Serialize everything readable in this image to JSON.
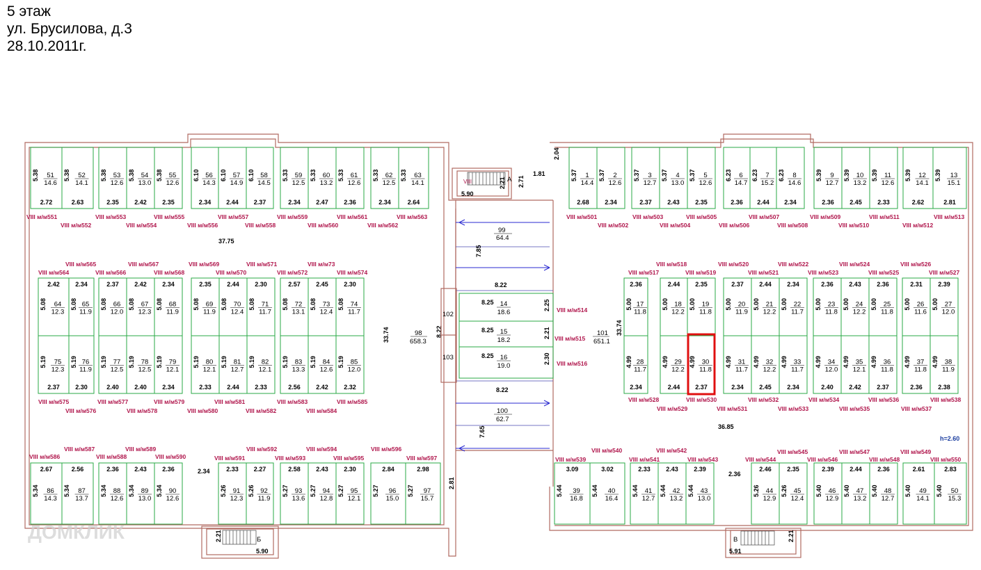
{
  "header": {
    "floor": "5 этаж",
    "address": "ул. Брусилова, д.3",
    "date": "28.10.2011г."
  },
  "watermark": "ДОМКЛИК",
  "colors": {
    "walls": "#b06a62",
    "boxes": "#28a845",
    "labels": "#b0164c",
    "highlight": "#e01010"
  },
  "rooms": [
    {
      "n": "51",
      "a": "14.6",
      "w": "5.38",
      "d": "2.72"
    },
    {
      "n": "52",
      "a": "14.1",
      "w": "5.38",
      "d": "2.63"
    },
    {
      "n": "53",
      "a": "12.6",
      "w": "5.38",
      "d": "2.35"
    },
    {
      "n": "54",
      "a": "13.0",
      "w": "5.38",
      "d": "2.42"
    },
    {
      "n": "55",
      "a": "12.6",
      "w": "5.38",
      "d": "2.35"
    },
    {
      "n": "56",
      "a": "14.3",
      "w": "6.10",
      "d": "2.34"
    },
    {
      "n": "57",
      "a": "14.9",
      "w": "6.10",
      "d": "2.44"
    },
    {
      "n": "58",
      "a": "14.5",
      "w": "6.10",
      "d": "2.37"
    },
    {
      "n": "59",
      "a": "12.5",
      "w": "5.33",
      "d": "2.34"
    },
    {
      "n": "60",
      "a": "13.2",
      "w": "5.33",
      "d": "2.47"
    },
    {
      "n": "61",
      "a": "12.6",
      "w": "5.33",
      "d": "2.36"
    },
    {
      "n": "62",
      "a": "12.5",
      "w": "5.33",
      "d": "2.34"
    },
    {
      "n": "63",
      "a": "14.1",
      "w": "5.33",
      "d": "2.64"
    },
    {
      "n": "64",
      "a": "12.3",
      "w": "5.08",
      "d": "2.42"
    },
    {
      "n": "65",
      "a": "11.9",
      "w": "5.08",
      "d": "2.34"
    },
    {
      "n": "66",
      "a": "12.0",
      "w": "5.08",
      "d": "2.37"
    },
    {
      "n": "67",
      "a": "12.3",
      "w": "5.08",
      "d": "2.42"
    },
    {
      "n": "68",
      "a": "11.9",
      "w": "5.08",
      "d": "2.34"
    },
    {
      "n": "69",
      "a": "11.9",
      "w": "5.08",
      "d": "2.35"
    },
    {
      "n": "70",
      "a": "12.4",
      "w": "5.08",
      "d": "2.44"
    },
    {
      "n": "71",
      "a": "11.7",
      "w": "5.08",
      "d": "2.30"
    },
    {
      "n": "72",
      "a": "13.1",
      "w": "5.08",
      "d": "2.57"
    },
    {
      "n": "73",
      "a": "12.4",
      "w": "5.08",
      "d": "2.45"
    },
    {
      "n": "74",
      "a": "11.7",
      "w": "5.08",
      "d": "2.30"
    },
    {
      "n": "75",
      "a": "12.3",
      "w": "5.19",
      "d": "2.37"
    },
    {
      "n": "76",
      "a": "11.9",
      "w": "5.19",
      "d": "2.30"
    },
    {
      "n": "77",
      "a": "12.5",
      "w": "5.19",
      "d": "2.40"
    },
    {
      "n": "78",
      "a": "12.5",
      "w": "5.19",
      "d": "2.40"
    },
    {
      "n": "79",
      "a": "12.1",
      "w": "5.19",
      "d": "2.34"
    },
    {
      "n": "80",
      "a": "12.1",
      "w": "5.19",
      "d": "2.33"
    },
    {
      "n": "81",
      "a": "12.7",
      "w": "5.19",
      "d": "2.44"
    },
    {
      "n": "82",
      "a": "12.1",
      "w": "5.19",
      "d": "2.33"
    },
    {
      "n": "83",
      "a": "13.3",
      "w": "5.19",
      "d": "2.56"
    },
    {
      "n": "84",
      "a": "12.6",
      "w": "5.19",
      "d": "2.42"
    },
    {
      "n": "85",
      "a": "12.0",
      "w": "5.19",
      "d": "2.32"
    },
    {
      "n": "86",
      "a": "14.3",
      "w": "5.34",
      "d": "2.67"
    },
    {
      "n": "87",
      "a": "13.7",
      "w": "5.34",
      "d": "2.56"
    },
    {
      "n": "88",
      "a": "12.6",
      "w": "5.34",
      "d": "2.36"
    },
    {
      "n": "89",
      "a": "13.0",
      "w": "5.34",
      "d": "2.43"
    },
    {
      "n": "90",
      "a": "12.6",
      "w": "5.34",
      "d": "2.36"
    },
    {
      "n": "91",
      "a": "12.3",
      "w": "5.26",
      "d": "2.33"
    },
    {
      "n": "92",
      "a": "11.9",
      "w": "5.26",
      "d": "2.27"
    },
    {
      "n": "93",
      "a": "13.6",
      "w": "5.27",
      "d": "2.58"
    },
    {
      "n": "94",
      "a": "12.8",
      "w": "5.27",
      "d": "2.43"
    },
    {
      "n": "95",
      "a": "12.1",
      "w": "5.27",
      "d": "2.30"
    },
    {
      "n": "96",
      "a": "15.0",
      "w": "5.27",
      "d": "2.84"
    },
    {
      "n": "97",
      "a": "15.7",
      "w": "5.27",
      "d": "2.98"
    },
    {
      "n": "1",
      "a": "14.4",
      "w": "5.37",
      "d": "2.68"
    },
    {
      "n": "2",
      "a": "12.6",
      "w": "5.37",
      "d": "2.34"
    },
    {
      "n": "3",
      "a": "12.7",
      "w": "5.37",
      "d": "2.37"
    },
    {
      "n": "4",
      "a": "13.0",
      "w": "5.37",
      "d": "2.43"
    },
    {
      "n": "5",
      "a": "12.6",
      "w": "5.37",
      "d": "2.35"
    },
    {
      "n": "6",
      "a": "14.7",
      "w": "6.23",
      "d": "2.36"
    },
    {
      "n": "7",
      "a": "15.2",
      "w": "6.23",
      "d": "2.44"
    },
    {
      "n": "8",
      "a": "14.6",
      "w": "6.23",
      "d": "2.34"
    },
    {
      "n": "9",
      "a": "12.7",
      "w": "5.39",
      "d": "2.36"
    },
    {
      "n": "10",
      "a": "13.2",
      "w": "5.39",
      "d": "2.45"
    },
    {
      "n": "11",
      "a": "12.6",
      "w": "5.39",
      "d": "2.33"
    },
    {
      "n": "12",
      "a": "14.1",
      "w": "5.39",
      "d": "2.62"
    },
    {
      "n": "13",
      "a": "15.1",
      "w": "5.39",
      "d": "2.81"
    },
    {
      "n": "17",
      "a": "11.8",
      "w": "5.00",
      "d": "2.36"
    },
    {
      "n": "18",
      "a": "12.2",
      "w": "5.00",
      "d": "2.44"
    },
    {
      "n": "19",
      "a": "11.8",
      "w": "5.00",
      "d": "2.35"
    },
    {
      "n": "20",
      "a": "11.9",
      "w": "5.00",
      "d": "2.37"
    },
    {
      "n": "21",
      "a": "12.2",
      "w": "5.00",
      "d": "2.44"
    },
    {
      "n": "22",
      "a": "11.7",
      "w": "5.00",
      "d": "2.34"
    },
    {
      "n": "23",
      "a": "11.8",
      "w": "5.00",
      "d": "2.36"
    },
    {
      "n": "24",
      "a": "12.2",
      "w": "5.00",
      "d": "2.43"
    },
    {
      "n": "25",
      "a": "11.8",
      "w": "5.00",
      "d": "2.36"
    },
    {
      "n": "26",
      "a": "11.6",
      "w": "5.00",
      "d": "2.31"
    },
    {
      "n": "27",
      "a": "12.0",
      "w": "5.00",
      "d": "2.39"
    },
    {
      "n": "28",
      "a": "11.7",
      "w": "4.99",
      "d": "2.34"
    },
    {
      "n": "29",
      "a": "12.2",
      "w": "4.99",
      "d": "2.44"
    },
    {
      "n": "30",
      "a": "11.8",
      "w": "4.99",
      "d": "2.37"
    },
    {
      "n": "31",
      "a": "11.7",
      "w": "4.99",
      "d": "2.34"
    },
    {
      "n": "32",
      "a": "12.2",
      "w": "4.99",
      "d": "2.45"
    },
    {
      "n": "33",
      "a": "11.7",
      "w": "4.99",
      "d": "2.34"
    },
    {
      "n": "34",
      "a": "12.0",
      "w": "4.99",
      "d": "2.40"
    },
    {
      "n": "35",
      "a": "12.1",
      "w": "4.99",
      "d": "2.42"
    },
    {
      "n": "36",
      "a": "11.8",
      "w": "4.99",
      "d": "2.37"
    },
    {
      "n": "37",
      "a": "11.8",
      "w": "4.99",
      "d": "2.36"
    },
    {
      "n": "38",
      "a": "11.9",
      "w": "4.99",
      "d": "2.38"
    },
    {
      "n": "39",
      "a": "16.8",
      "w": "5.44",
      "d": "3.09"
    },
    {
      "n": "40",
      "a": "16.4",
      "w": "5.44",
      "d": "3.02"
    },
    {
      "n": "41",
      "a": "12.7",
      "w": "5.44",
      "d": "2.33"
    },
    {
      "n": "42",
      "a": "13.2",
      "w": "5.44",
      "d": "2.43"
    },
    {
      "n": "43",
      "a": "13.0",
      "w": "5.44",
      "d": "2.39"
    },
    {
      "n": "44",
      "a": "12.9",
      "w": "5.26",
      "d": "2.46"
    },
    {
      "n": "45",
      "a": "12.4",
      "w": "5.26",
      "d": "2.35"
    },
    {
      "n": "46",
      "a": "12.9",
      "w": "5.40",
      "d": "2.39"
    },
    {
      "n": "47",
      "a": "13.2",
      "w": "5.40",
      "d": "2.44"
    },
    {
      "n": "48",
      "a": "12.7",
      "w": "5.40",
      "d": "2.36"
    },
    {
      "n": "49",
      "a": "14.1",
      "w": "5.40",
      "d": "2.61"
    },
    {
      "n": "50",
      "a": "15.3",
      "w": "5.40",
      "d": "2.83"
    },
    {
      "n": "14",
      "a": "18.6",
      "w": "8.25",
      "d": "2.25"
    },
    {
      "n": "15",
      "a": "18.2",
      "w": "8.25",
      "d": "2.21"
    },
    {
      "n": "16",
      "a": "19.0",
      "w": "8.25",
      "d": "2.30"
    }
  ],
  "labels": {
    "L551": "VIII м/м551",
    "L552": "VIII м/м552",
    "L553": "VIII м/м553",
    "L554": "VIII м/м554",
    "L555": "VIII м/м555",
    "L556": "VIII м/м556",
    "L557": "VIII м/м557",
    "L558": "VIII м/м558",
    "L559": "VIII м/м559",
    "L560": "VIII м/м560",
    "L561": "VIII м/м561",
    "L562": "VIII м/м562",
    "L563": "VIII м/м563",
    "L564": "VIII м/м564",
    "L565": "VIII м/м565",
    "L566": "VIII м/м566",
    "L567": "VIII м/м567",
    "L568": "VIII м/м568",
    "L569": "VIII м/м569",
    "L570": "VIII м/м570",
    "L571": "VIII м/м571",
    "L572": "VIII м/м572",
    "L573": "VIII м/м73",
    "L574": "VIII м/м574",
    "L575": "VIII м/м575",
    "L576": "VIII м/м576",
    "L577": "VIII м/м577",
    "L578": "VIII м/м578",
    "L579": "VIII м/м579",
    "L580": "VIII м/м580",
    "L581": "VIII м/м581",
    "L582": "VIII м/м582",
    "L583": "VIII м/м583",
    "L584": "VIII м/м584",
    "L585": "VIII м/м585",
    "L586": "VIII м/м586",
    "L587": "VIII м/м587",
    "L588": "VIII м/м588",
    "L589": "VIII м/м589",
    "L590": "VIII м/м590",
    "L591": "VIII м/м591",
    "L592": "VIII м/м592",
    "L593": "VIII м/м593",
    "L594": "VIII м/м594",
    "L595": "VIII м/м595",
    "L596": "VIII м/м596",
    "L597": "VIII м/м597",
    "L501": "VIII м/м501",
    "L502": "VIII м/м502",
    "L503": "VIII м/м503",
    "L504": "VIII м/м504",
    "L505": "VIII м/м505",
    "L506": "VIII м/м506",
    "L507": "VIII м/м507",
    "L508": "VIII м/м508",
    "L509": "VIII м/м509",
    "L510": "VIII м/м510",
    "L511": "VIII м/м511",
    "L512": "VIII м/м512",
    "L513": "VIII м/м513",
    "L514": "VIII м/м514",
    "L515": "VIII м/м515",
    "L516": "VIII м/м516",
    "L517": "VIII м/м517",
    "L518": "VIII м/м518",
    "L519": "VIII м/м519",
    "L520": "VIII м/м520",
    "L521": "VIII м/м521",
    "L522": "VIII м/м522",
    "L523": "VIII м/м523",
    "L524": "VIII м/м524",
    "L525": "VIII м/м525",
    "L526": "VIII м/м526",
    "L527": "VIII м/м527",
    "L528": "VIII м/м528",
    "L529": "VIII м/м529",
    "L530": "VIII м/м530",
    "L531": "VIII м/м531",
    "L532": "VIII м/м532",
    "L533": "VIII м/м533",
    "L534": "VIII м/м534",
    "L535": "VIII м/м535",
    "L536": "VIII м/м536",
    "L537": "VIII м/м537",
    "L538": "VIII м/м538",
    "L539": "VIII м/м539",
    "L540": "VIII м/м540",
    "L541": "VIII м/м541",
    "L542": "VIII м/м542",
    "L543": "VIII м/м543",
    "L544": "VIII м/м544",
    "L545": "VIII м/м545",
    "L546": "VIII м/м546",
    "L547": "VIII м/м547",
    "L548": "VIII м/м548",
    "L549": "VIII м/м549",
    "L550": "VIII м/м550"
  },
  "dims": {
    "d3775": "37.75",
    "d3374a": "33.74",
    "d3374b": "33.74",
    "d3685": "36.85",
    "d822a": "8.22",
    "d822b": "8.22",
    "d822c": "8.22",
    "d785": "7.85",
    "d765": "7.65",
    "d204": "2.04",
    "d181": "1.81",
    "d271": "2.71",
    "d221a": "2.21",
    "d590a": "5.90",
    "d221b": "2.21",
    "d590b": "5.90",
    "d221c": "2.21",
    "d591": "5.91",
    "d281": "2.81",
    "d234": "2.34",
    "d236": "2.36",
    "h": "h=2.60"
  },
  "spaces": {
    "s98n": "98",
    "s98a": "658.3",
    "s101n": "101",
    "s101a": "651.1",
    "s99n": "99",
    "s99a": "64.4",
    "s100n": "100",
    "s100a": "62.7",
    "s102": "102",
    "s103": "103",
    "stA": "А",
    "stB": "Б",
    "stV": "В",
    "stVIII": "VIII"
  }
}
